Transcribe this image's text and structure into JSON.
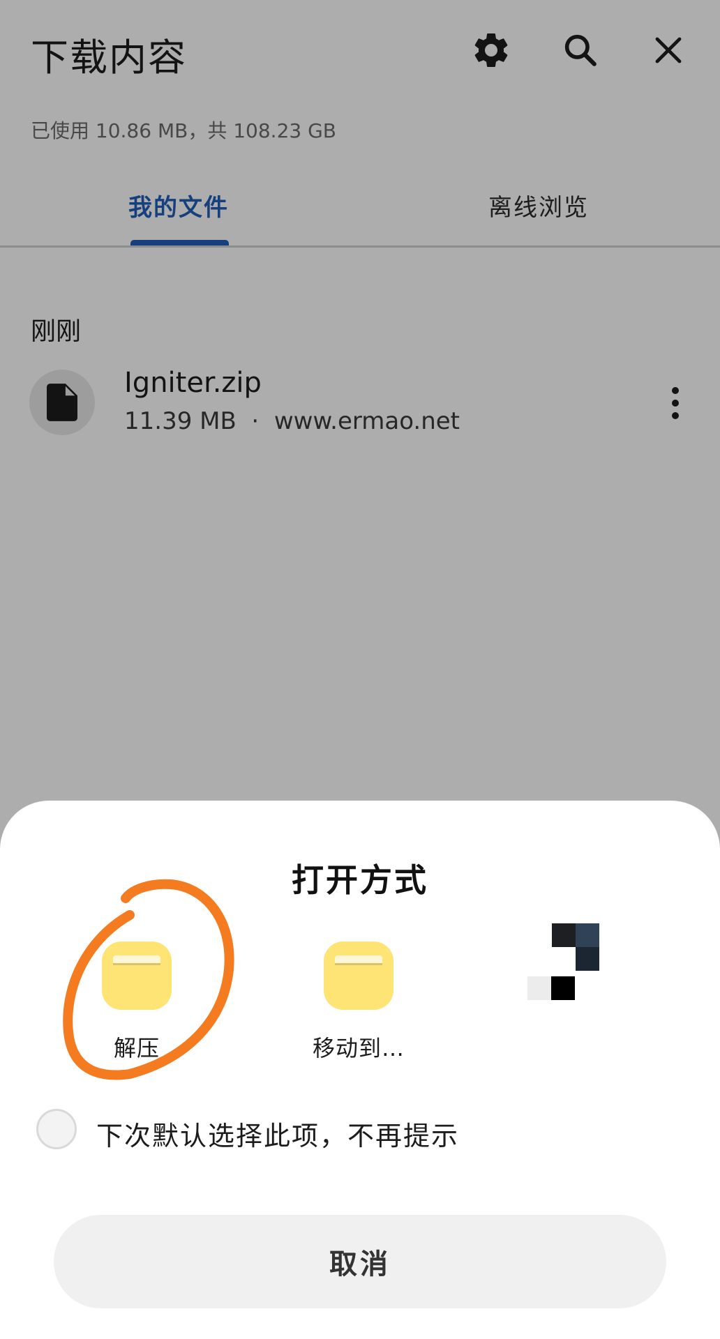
{
  "header": {
    "title": "下载内容",
    "icons": [
      "gear-icon",
      "search-icon",
      "close-icon"
    ]
  },
  "storage_info": "已使用 10.86 MB，共 108.23 GB",
  "tabs": [
    {
      "label": "我的文件",
      "selected": true
    },
    {
      "label": "离线浏览",
      "selected": false
    }
  ],
  "section_label": "刚刚",
  "download": {
    "name": "Igniter.zip",
    "meta": "11.39 MB  ·  www.ermao.net"
  },
  "colors": {
    "accent": "#1f5fb8",
    "app_icon": "#fde474",
    "annotation": "#f47b20"
  },
  "sheet": {
    "title": "打开方式",
    "apps": [
      {
        "label": "解压",
        "icon": "folder-icon"
      },
      {
        "label": "移动到…",
        "icon": "folder-icon"
      },
      {
        "label": "",
        "icon": "pixelated-app-icon"
      }
    ],
    "remember_label": "下次默认选择此项，不再提示",
    "remember_checked": false,
    "cancel_label": "取消"
  }
}
